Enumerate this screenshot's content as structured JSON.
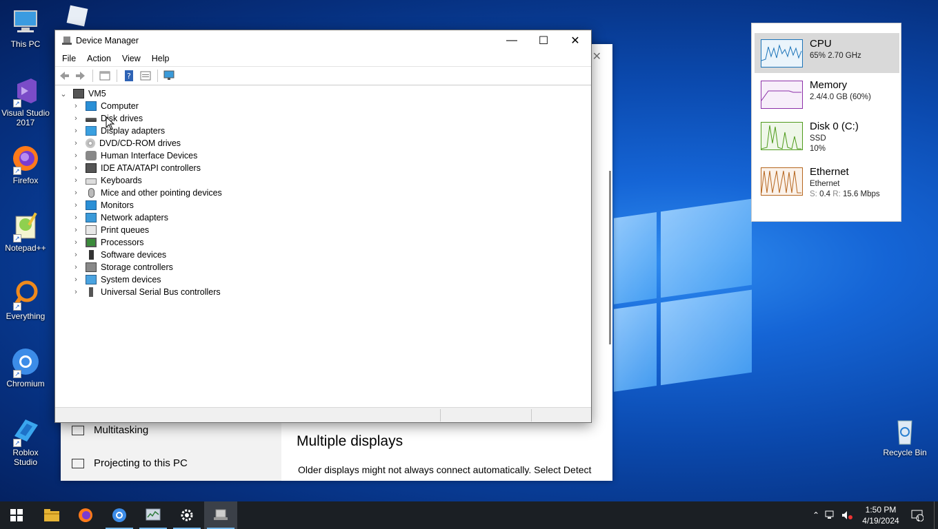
{
  "desktop": {
    "icons": [
      {
        "label": "This PC"
      },
      {
        "label": "Visual Studio 2017"
      },
      {
        "label": "Firefox"
      },
      {
        "label": "Notepad++"
      },
      {
        "label": "Everything"
      },
      {
        "label": "Chromium"
      },
      {
        "label": "Roblox Studio"
      },
      {
        "label": "Recycle Bin"
      }
    ]
  },
  "settings": {
    "nav": [
      {
        "label": "Multitasking"
      },
      {
        "label": "Projecting to this PC"
      }
    ],
    "heading": "Multiple displays",
    "paragraph": "Older displays might not always connect automatically. Select Detect"
  },
  "device_manager": {
    "title": "Device Manager",
    "menu": [
      "File",
      "Action",
      "View",
      "Help"
    ],
    "root": "VM5",
    "categories": [
      {
        "label": "Computer",
        "icon": "computer-icon"
      },
      {
        "label": "Disk drives",
        "icon": "disk-drive-icon"
      },
      {
        "label": "Display adapters",
        "icon": "display-adapter-icon"
      },
      {
        "label": "DVD/CD-ROM drives",
        "icon": "dvd-icon"
      },
      {
        "label": "Human Interface Devices",
        "icon": "hid-icon"
      },
      {
        "label": "IDE ATA/ATAPI controllers",
        "icon": "ide-controller-icon"
      },
      {
        "label": "Keyboards",
        "icon": "keyboard-icon"
      },
      {
        "label": "Mice and other pointing devices",
        "icon": "mouse-icon"
      },
      {
        "label": "Monitors",
        "icon": "monitor-icon"
      },
      {
        "label": "Network adapters",
        "icon": "network-adapter-icon"
      },
      {
        "label": "Print queues",
        "icon": "printer-icon"
      },
      {
        "label": "Processors",
        "icon": "processor-icon"
      },
      {
        "label": "Software devices",
        "icon": "software-device-icon"
      },
      {
        "label": "Storage controllers",
        "icon": "storage-controller-icon"
      },
      {
        "label": "System devices",
        "icon": "system-device-icon"
      },
      {
        "label": "Universal Serial Bus controllers",
        "icon": "usb-icon"
      }
    ]
  },
  "task_manager": {
    "cpu": {
      "name": "CPU",
      "line1": "65%  2.70 GHz",
      "color": "#1a73b8"
    },
    "memory": {
      "name": "Memory",
      "line1": "2.4/4.0 GB (60%)",
      "color": "#8b2fa8"
    },
    "disk": {
      "name": "Disk 0 (C:)",
      "line1": "SSD",
      "line2": "10%",
      "color": "#4d9a1a"
    },
    "ethernet": {
      "name": "Ethernet",
      "line1": "Ethernet",
      "send_label": "S:",
      "send": "0.4",
      "recv_label": "R:",
      "recv": "15.6 Mbps",
      "color": "#b5651d"
    }
  },
  "taskbar": {
    "clock_time": "1:50 PM",
    "clock_date": "4/19/2024",
    "notification_count": "1"
  }
}
